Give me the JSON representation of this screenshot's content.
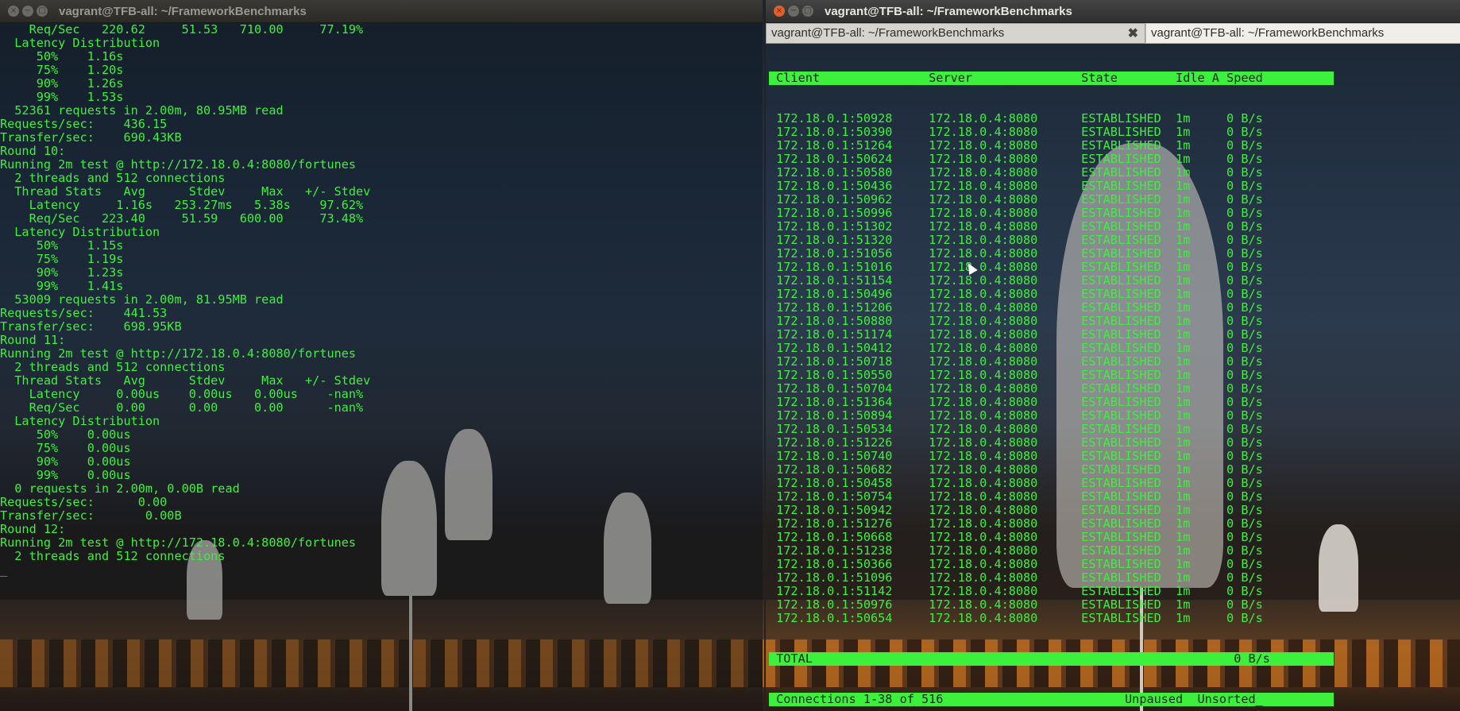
{
  "left_window": {
    "title": "vagrant@TFB-all: ~/FrameworkBenchmarks",
    "lines": [
      "    Req/Sec   220.62     51.53   710.00     77.19%",
      "  Latency Distribution",
      "     50%    1.16s",
      "     75%    1.20s",
      "     90%    1.26s",
      "     99%    1.53s",
      "  52361 requests in 2.00m, 80.95MB read",
      "Requests/sec:    436.15",
      "Transfer/sec:    690.43KB",
      "Round 10:",
      "Running 2m test @ http://172.18.0.4:8080/fortunes",
      "  2 threads and 512 connections",
      "  Thread Stats   Avg      Stdev     Max   +/- Stdev",
      "    Latency     1.16s   253.27ms   5.38s    97.62%",
      "    Req/Sec   223.40     51.59   600.00     73.48%",
      "  Latency Distribution",
      "     50%    1.15s",
      "     75%    1.19s",
      "     90%    1.23s",
      "     99%    1.41s",
      "  53009 requests in 2.00m, 81.95MB read",
      "Requests/sec:    441.53",
      "Transfer/sec:    698.95KB",
      "Round 11:",
      "Running 2m test @ http://172.18.0.4:8080/fortunes",
      "  2 threads and 512 connections",
      "  Thread Stats   Avg      Stdev     Max   +/- Stdev",
      "    Latency     0.00us    0.00us   0.00us    -nan%",
      "    Req/Sec     0.00      0.00     0.00      -nan%",
      "  Latency Distribution",
      "     50%    0.00us",
      "     75%    0.00us",
      "     90%    0.00us",
      "     99%    0.00us",
      "  0 requests in 2.00m, 0.00B read",
      "Requests/sec:      0.00",
      "Transfer/sec:       0.00B",
      "Round 12:",
      "Running 2m test @ http://172.18.0.4:8080/fortunes",
      "  2 threads and 512 connections",
      "_"
    ]
  },
  "right_window": {
    "title": "vagrant@TFB-all: ~/FrameworkBenchmarks",
    "tabs": [
      {
        "label": "vagrant@TFB-all: ~/FrameworkBenchmarks"
      },
      {
        "label": "vagrant@TFB-all: ~/FrameworkBenchmarks"
      }
    ],
    "header": " Client               Server               State        Idle A Speed",
    "rows": [
      " 172.18.0.1:50928     172.18.0.4:8080      ESTABLISHED  1m     0 B/s",
      " 172.18.0.1:50390     172.18.0.4:8080      ESTABLISHED  1m     0 B/s",
      " 172.18.0.1:51264     172.18.0.4:8080      ESTABLISHED  1m     0 B/s",
      " 172.18.0.1:50624     172.18.0.4:8080      ESTABLISHED  1m     0 B/s",
      " 172.18.0.1:50580     172.18.0.4:8080      ESTABLISHED  1m     0 B/s",
      " 172.18.0.1:50436     172.18.0.4:8080      ESTABLISHED  1m     0 B/s",
      " 172.18.0.1:50962     172.18.0.4:8080      ESTABLISHED  1m     0 B/s",
      " 172.18.0.1:50996     172.18.0.4:8080      ESTABLISHED  1m     0 B/s",
      " 172.18.0.1:51302     172.18.0.4:8080      ESTABLISHED  1m     0 B/s",
      " 172.18.0.1:51320     172.18.0.4:8080      ESTABLISHED  1m     0 B/s",
      " 172.18.0.1:51056     172.18.0.4:8080      ESTABLISHED  1m     0 B/s",
      " 172.18.0.1:51016     172.18.0.4:8080      ESTABLISHED  1m     0 B/s",
      " 172.18.0.1:51154     172.18.0.4:8080      ESTABLISHED  1m     0 B/s",
      " 172.18.0.1:50496     172.18.0.4:8080      ESTABLISHED  1m     0 B/s",
      " 172.18.0.1:51206     172.18.0.4:8080      ESTABLISHED  1m     0 B/s",
      " 172.18.0.1:50880     172.18.0.4:8080      ESTABLISHED  1m     0 B/s",
      " 172.18.0.1:51174     172.18.0.4:8080      ESTABLISHED  1m     0 B/s",
      " 172.18.0.1:50412     172.18.0.4:8080      ESTABLISHED  1m     0 B/s",
      " 172.18.0.1:50718     172.18.0.4:8080      ESTABLISHED  1m     0 B/s",
      " 172.18.0.1:50550     172.18.0.4:8080      ESTABLISHED  1m     0 B/s",
      " 172.18.0.1:50704     172.18.0.4:8080      ESTABLISHED  1m     0 B/s",
      " 172.18.0.1:51364     172.18.0.4:8080      ESTABLISHED  1m     0 B/s",
      " 172.18.0.1:50894     172.18.0.4:8080      ESTABLISHED  1m     0 B/s",
      " 172.18.0.1:50534     172.18.0.4:8080      ESTABLISHED  1m     0 B/s",
      " 172.18.0.1:51226     172.18.0.4:8080      ESTABLISHED  1m     0 B/s",
      " 172.18.0.1:50740     172.18.0.4:8080      ESTABLISHED  1m     0 B/s",
      " 172.18.0.1:50682     172.18.0.4:8080      ESTABLISHED  1m     0 B/s",
      " 172.18.0.1:50458     172.18.0.4:8080      ESTABLISHED  1m     0 B/s",
      " 172.18.0.1:50754     172.18.0.4:8080      ESTABLISHED  1m     0 B/s",
      " 172.18.0.1:50942     172.18.0.4:8080      ESTABLISHED  1m     0 B/s",
      " 172.18.0.1:51276     172.18.0.4:8080      ESTABLISHED  1m     0 B/s",
      " 172.18.0.1:50668     172.18.0.4:8080      ESTABLISHED  1m     0 B/s",
      " 172.18.0.1:51238     172.18.0.4:8080      ESTABLISHED  1m     0 B/s",
      " 172.18.0.1:50366     172.18.0.4:8080      ESTABLISHED  1m     0 B/s",
      " 172.18.0.1:51096     172.18.0.4:8080      ESTABLISHED  1m     0 B/s",
      " 172.18.0.1:51142     172.18.0.4:8080      ESTABLISHED  1m     0 B/s",
      " 172.18.0.1:50976     172.18.0.4:8080      ESTABLISHED  1m     0 B/s",
      " 172.18.0.1:50654     172.18.0.4:8080      ESTABLISHED  1m     0 B/s"
    ],
    "total_line": " TOTAL                                                          0 B/s",
    "status_line": " Connections 1-38 of 516                         Unpaused  Unsorted_"
  },
  "colors": {
    "terminal_text": "#3cf03c",
    "bar_bg": "#3cf03c",
    "close_button": "#e0602c"
  }
}
